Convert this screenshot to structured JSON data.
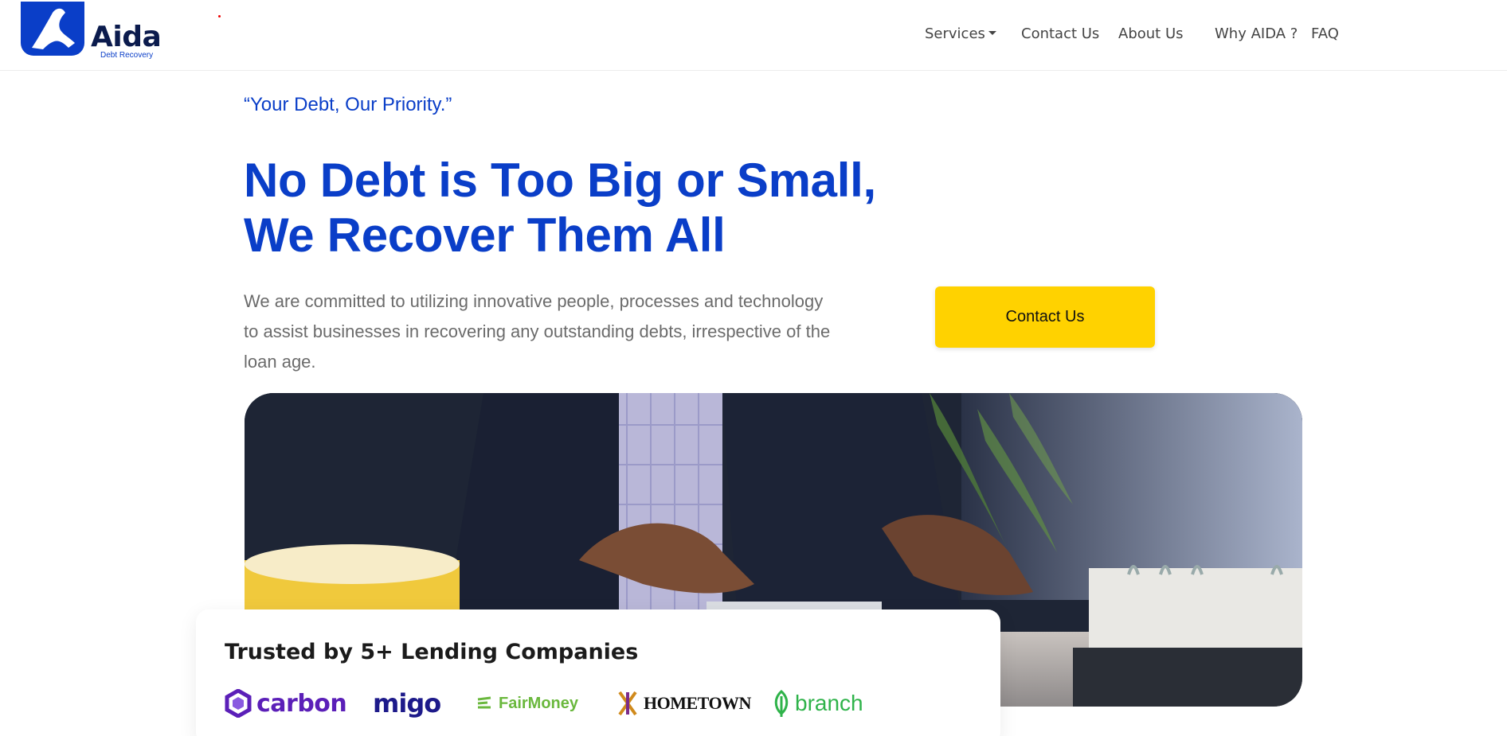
{
  "brand": {
    "name": "Aida",
    "sub": "Debt Recovery",
    "color": "#0a3ec8"
  },
  "nav": {
    "services": "Services",
    "contact": "Contact Us",
    "about": "About Us",
    "why": "Why AIDA ?",
    "faq": "FAQ"
  },
  "hero": {
    "tagline": "“Your Debt, Our Priority.”",
    "headline_line1": "No Debt is Too Big or Small,",
    "headline_line2": "We Recover Them All",
    "description": "We are committed to utilizing innovative people, processes and technology to assist businesses in recovering any outstanding debts, irrespective of the loan age.",
    "cta_label": "Contact Us",
    "cta_color": "#ffd200"
  },
  "trust": {
    "title": "Trusted by 5+ Lending Companies",
    "partners": {
      "carbon": "carbon",
      "migo": "migo",
      "fairmoney": "FairMoney",
      "hometown": "HOMETOWN",
      "branch": "branch"
    }
  }
}
